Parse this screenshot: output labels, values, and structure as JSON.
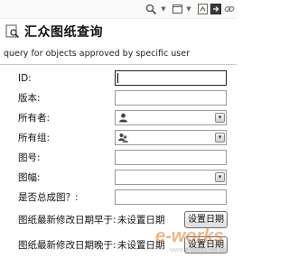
{
  "toolbar": {
    "icons": [
      "zoom-icon",
      "chevron-down-icon",
      "window-icon",
      "chevron-down-icon",
      "refresh-icon",
      "export-icon",
      "link-icon"
    ]
  },
  "header": {
    "title": "汇众图纸查询",
    "subtitle": "query for objects approved by specific user"
  },
  "form": {
    "id": {
      "label": "ID:",
      "value": ""
    },
    "version": {
      "label": "版本:",
      "value": ""
    },
    "owner": {
      "label": "所有者:",
      "value": "",
      "icon": "user-icon"
    },
    "owner_group": {
      "label": "所有组:",
      "value": "",
      "icon": "group-icon"
    },
    "drawing_no": {
      "label": "图号:",
      "value": ""
    },
    "sheet_size": {
      "label": "图幅:",
      "value": ""
    },
    "is_assembly": {
      "label": "是否总成图？:",
      "value": ""
    },
    "modified_before": {
      "label": "图纸最新修改日期早于:",
      "value": "未设置日期",
      "button": "设置日期"
    },
    "modified_after": {
      "label": "图纸最新修改日期晚于:",
      "value": "未设置日期",
      "button": "设置日期"
    }
  },
  "watermark": {
    "text": "e-works",
    "subtext": "www.e-works.net.cn"
  },
  "colors": {
    "accent": "#e07a2a",
    "border": "#9a9a9a"
  }
}
